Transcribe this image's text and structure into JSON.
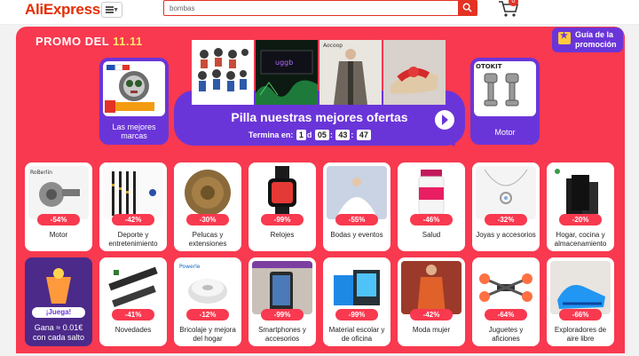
{
  "header": {
    "logo": "AliExpress",
    "search_value": "bombas",
    "cart_count": "0"
  },
  "promo": {
    "title_prefix": "PROMO DEL",
    "title_number": "11.11",
    "guide_label": "Guía de la promoción",
    "left_card_label": "Las mejores marcas",
    "right_card_label": "Motor",
    "center_title": "Pilla nuestras mejores ofertas",
    "timer_label": "Termina en:",
    "timer": {
      "d": "1",
      "d_sep": "d",
      "h": "05",
      "m": "43",
      "s": "47"
    },
    "right_brand": "OTOKIT"
  },
  "tiles_row1": [
    {
      "name": "Motor",
      "discount": "-54%"
    },
    {
      "name": "Deporte y entretenimiento",
      "discount": "-42%"
    },
    {
      "name": "Pelucas y extensiones",
      "discount": "-30%"
    },
    {
      "name": "Relojes",
      "discount": "-99%"
    },
    {
      "name": "Bodas y eventos",
      "discount": "-55%"
    },
    {
      "name": "Salud",
      "discount": "-46%"
    },
    {
      "name": "Joyas y accesorios",
      "discount": "-32%"
    },
    {
      "name": "Hogar, cocina y almacenamiento",
      "discount": "-20%"
    }
  ],
  "game_tile": {
    "button": "¡Juega!",
    "line1": "Gana ≈ 0.01€",
    "line2": "con cada salto"
  },
  "tiles_row2": [
    {
      "name": "Novedades",
      "discount": "-41%"
    },
    {
      "name": "Bricolaje y mejora del hogar",
      "discount": "-12%"
    },
    {
      "name": "Smartphones y accesorios",
      "discount": "-99%"
    },
    {
      "name": "Material escolar y de oficina",
      "discount": "-99%"
    },
    {
      "name": "Moda mujer",
      "discount": "-42%"
    },
    {
      "name": "Juguetes y aficiones",
      "discount": "-64%"
    },
    {
      "name": "Exploradores de aire libre",
      "discount": "-66%"
    }
  ],
  "colors": {
    "brand": "#e62e04",
    "promo_red": "#f8394f",
    "purple": "#6a35d8"
  }
}
